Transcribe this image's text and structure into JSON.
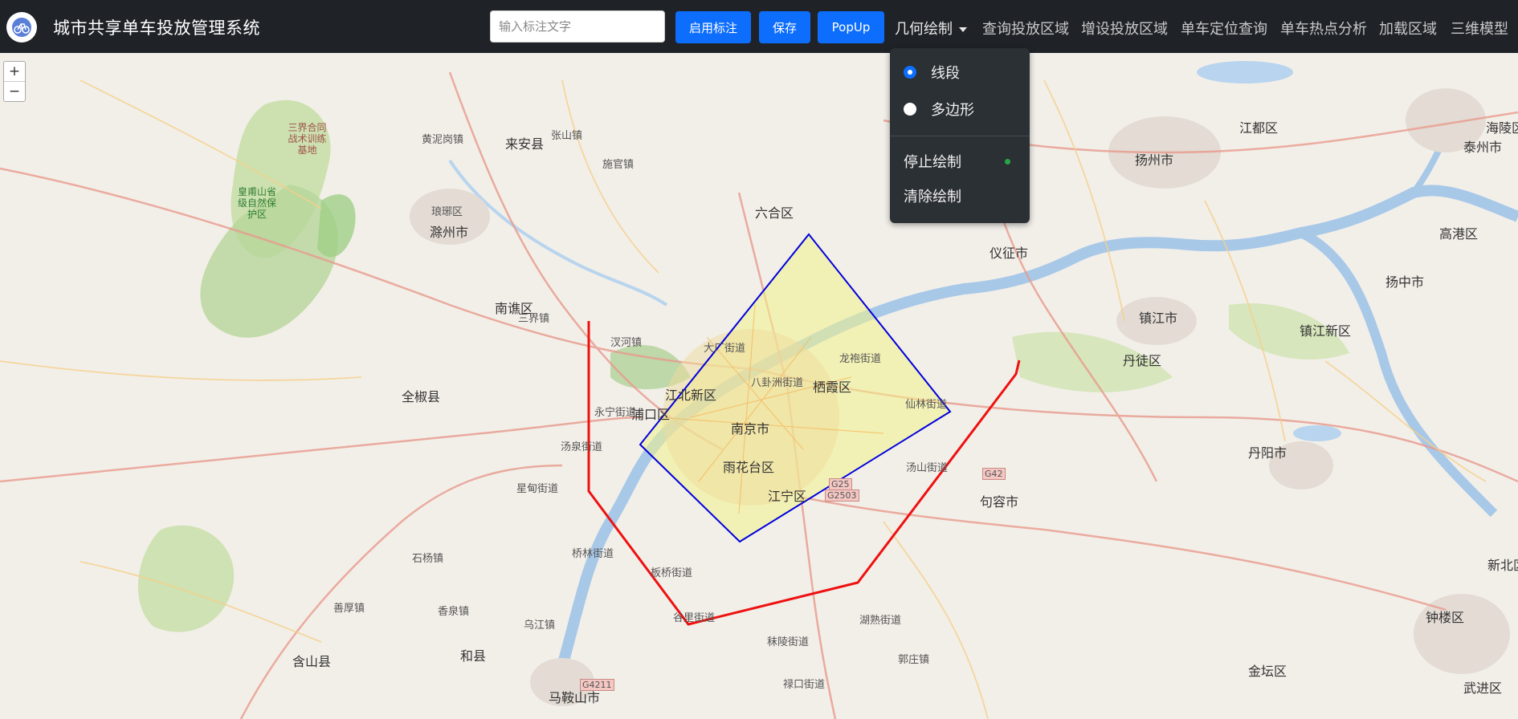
{
  "header": {
    "title": "城市共享单车投放管理系统",
    "search_placeholder": "输入标注文字",
    "buttons": {
      "enable_marker": "启用标注",
      "save": "保存",
      "popup": "PopUp"
    },
    "nav": {
      "geometry_draw": "几何绘制",
      "query_area": "查询投放区域",
      "add_area": "增设投放区域",
      "bike_locate": "单车定位查询",
      "hotspot": "单车热点分析",
      "load_area": "加载区域",
      "model_3d": "三维模型"
    }
  },
  "geometry_menu": {
    "line": "线段",
    "polygon": "多边形",
    "stop": "停止绘制",
    "clear": "清除绘制",
    "selected": "line"
  },
  "map": {
    "zoom_in": "+",
    "zoom_out": "−",
    "colors": {
      "line": "#ee1111",
      "polygon": "#0000dd",
      "polygon_fill": "#f2f28a"
    },
    "labels": [
      "来安县",
      "滁州市",
      "琅琊区",
      "南谯区",
      "全椒县",
      "江北新区",
      "浦口区",
      "南京市",
      "栖霞区",
      "雨花台区",
      "江宁区",
      "六合区",
      "仪征市",
      "扬州市",
      "江都区",
      "镇江市",
      "丹徒区",
      "句容市",
      "丹阳市",
      "和县",
      "含山县",
      "马鞍山市",
      "金坛区",
      "高港区",
      "泰州市",
      "扬中市",
      "镇江新区",
      "钟楼区",
      "武进区",
      "新北区",
      "海陵区",
      "G42",
      "G4211",
      "G25",
      "G2503",
      "汤山街道",
      "仙林街道",
      "龙袍街道",
      "八卦洲街道",
      "大厂街道",
      "永宁街道",
      "汤泉街道",
      "星甸街道",
      "桥林街道",
      "板桥街道",
      "谷里街道",
      "禄口街道",
      "秣陵街道",
      "湖熟街道",
      "郭庄镇",
      "三界镇",
      "施官镇",
      "汊河镇",
      "黄泥岗镇",
      "张山镇",
      "乌江镇",
      "石杨镇",
      "香泉镇",
      "善厚镇",
      "三界合同战术训练基地",
      "皇甫山省级自然保护区"
    ]
  }
}
